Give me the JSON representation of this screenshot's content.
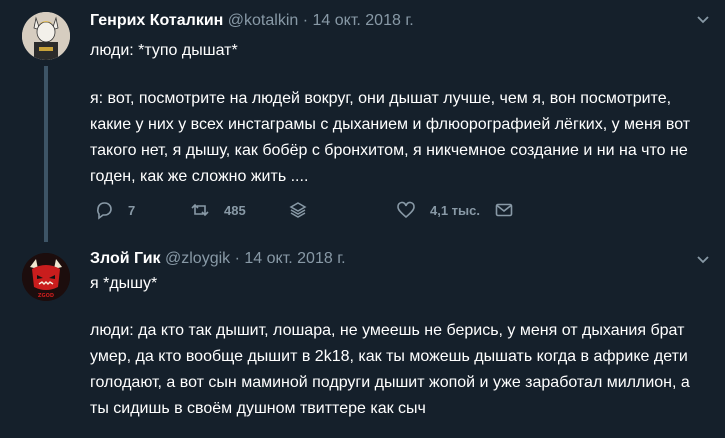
{
  "tweets": [
    {
      "author_name": "Генрих Коталкин",
      "handle": "@kotalkin",
      "separator": "·",
      "date": "14 окт. 2018 г.",
      "line1": "люди: *тупо дышат*",
      "paragraph": "я: вот, посмотрите на людей вокруг, они дышат лучше, чем я, вон посмотрите, какие у них у всех инстаграмы с дыханием и флюорографией лёгких, у меня вот такого нет, я дышу, как бобёр с бронхитом, я никчемное создание и ни на что не годен, как же сложно жить ....",
      "actions": {
        "replies": "7",
        "retweets": "485",
        "likes": "4,1 тыс."
      }
    },
    {
      "author_name": "Злой Гик",
      "handle": "@zloygik",
      "separator": "·",
      "date": "14 окт. 2018 г.",
      "line1": "я *дышу*",
      "paragraph": "люди: да кто так дышит, лошара, не умеешь не берись, у меня от дыхания брат умер, да кто вообще дышит в 2k18, как ты можешь дышать когда в африке дети голодают, а вот сын маминой подруги дышит жопой и уже заработал миллион, а ты сидишь в своём душном твиттере как сыч"
    }
  ],
  "icons": {
    "reply": "reply-icon",
    "retweet": "retweet-icon",
    "stack": "stack-icon",
    "like": "heart-icon",
    "message": "envelope-icon",
    "more": "chevron-down-icon"
  },
  "avatar2_text": "ZGOD",
  "colors": {
    "background": "#15202b",
    "muted": "#8899a6",
    "thread": "#3d5466",
    "text": "#ffffff"
  }
}
